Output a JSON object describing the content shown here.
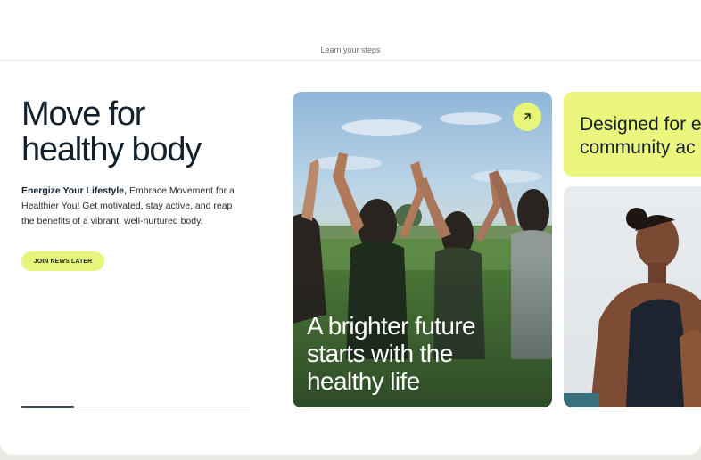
{
  "header": {
    "subtitle": "Learn your steps"
  },
  "hero": {
    "title_line1": "Move for",
    "title_line2": "healthy body",
    "description_bold": "Energize Your Lifestyle,",
    "description_rest": " Embrace Movement for a Healthier You! Get motivated, stay active, and reap the benefits of a vibrant, well-nurtured body.",
    "cta_label": "JOIN NEWS LATER"
  },
  "carousel": {
    "progress_fraction": 0.23
  },
  "cards": {
    "main": {
      "title_line1": "A brighter future",
      "title_line2": "starts with the",
      "title_line3": "healthy life",
      "arrow_icon": "arrow-up-right-icon"
    },
    "secondary": {
      "title_line1": "Designed for e",
      "title_line2": "community ac"
    },
    "yoga": {
      "image": "woman-meditating-photo"
    }
  },
  "colors": {
    "accent": "#e7f57a",
    "text_dark": "#14202b"
  }
}
